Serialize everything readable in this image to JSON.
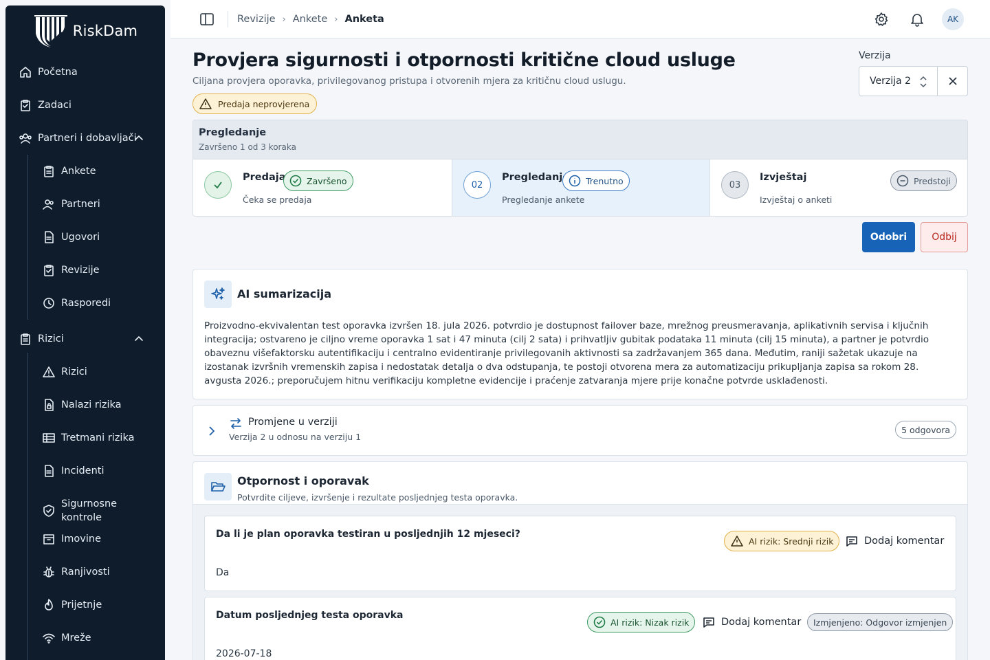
{
  "app": {
    "name": "RiskDam"
  },
  "sidebar": {
    "items": [
      {
        "label": "Početna"
      },
      {
        "label": "Zadaci"
      },
      {
        "label": "Partneri i dobavljači"
      },
      {
        "label": "Ankete"
      },
      {
        "label": "Partneri"
      },
      {
        "label": "Ugovori"
      },
      {
        "label": "Revizije"
      },
      {
        "label": "Rasporedi"
      },
      {
        "label": "Rizici"
      },
      {
        "label": "Rizici"
      },
      {
        "label": "Nalazi rizika"
      },
      {
        "label": "Tretmani rizika"
      },
      {
        "label": "Incidenti"
      },
      {
        "label": "Sigurnosne kontrole"
      },
      {
        "label": "Imovine"
      },
      {
        "label": "Ranjivosti"
      },
      {
        "label": "Prijetnje"
      },
      {
        "label": "Mreže"
      }
    ]
  },
  "breadcrumb": [
    "Revizije",
    "Ankete",
    "Anketa"
  ],
  "user": {
    "initials": "AK"
  },
  "header": {
    "title": "Provjera sigurnosti i otpornosti kritične cloud usluge",
    "subtitle": "Ciljana provjera oporavka, privilegovanog pristupa i otvorenih mjera za kritičnu cloud uslugu.",
    "status_badge": "Predaja neprovjerena"
  },
  "version": {
    "label": "Verzija",
    "selected": "Verzija 2"
  },
  "stepper": {
    "title": "Pregledanje",
    "progress": "Završeno 1 od 3 koraka",
    "steps": [
      {
        "number": "",
        "name": "Predaja",
        "status": "Završeno",
        "desc": "Čeka se predaja"
      },
      {
        "number": "02",
        "name": "Pregledanje",
        "status": "Trenutno",
        "desc": "Pregledanje ankete"
      },
      {
        "number": "03",
        "name": "Izvještaj",
        "status": "Predstoji",
        "desc": "Izvještaj o anketi"
      }
    ]
  },
  "actions": {
    "approve": "Odobri",
    "reject": "Odbij"
  },
  "ai_summary": {
    "title": "AI sumarizacija",
    "text": "Proizvodno-ekvivalentan test oporavka izvršen 18. jula 2026. potvrdio je dostupnost failover baze, mrežnog preusmeravanja, aplikativnih servisa i ključnih integracija; ostvareno je ciljno vreme oporavka 1 sat i 47 minuta (cilj 2 sata) i prihvatljiv gubitak podataka 11 minuta (cilj 15 minuta), a partner je potvrdio obaveznu višefaktorsku autentifikaciju i centralno evidentiranje privilegovanih aktivnosti sa zadržavanjem 365 dana. Međutim, raniji sažetak ukazuje na izostanak izvršnih vremenskih zapisa i nedostatak detalja o dva odstupanja, te postoji otvorena mera za automatizaciju prikupljanja zapisa sa rokom 28. avgusta 2026.; preporučujem hitnu verifikaciju kompletne evidencije i praćenje zatvaranja mjere prije konačne potvrde usklađenosti."
  },
  "changes": {
    "title": "Promjene u verziji",
    "subtitle": "Verzija 2 u odnosu na verziju 1",
    "count": "5 odgovora"
  },
  "section": {
    "title": "Otpornost i oporavak",
    "subtitle": "Potvrdite ciljeve, izvršenje i rezultate posljednjeg testa oporavka.",
    "questions": [
      {
        "question": "Da li je plan oporavka testiran u posljednjih 12 mjeseci?",
        "risk": "AI rizik: Srednji rizik",
        "comment": "Dodaj komentar",
        "answer": "Da",
        "changed": ""
      },
      {
        "question": "Datum posljednjeg testa oporavka",
        "risk": "AI rizik: Nizak rizik",
        "comment": "Dodaj komentar",
        "answer": "2026-07-18",
        "changed": "Izmjenjeno: Odgovor izmjenjen"
      }
    ]
  },
  "colors": {
    "sidebar_bg": "#0f1c2b",
    "primary": "#1763b7",
    "danger": "#b8281f",
    "success": "#1e7a46",
    "warning": "#e2b14a"
  }
}
